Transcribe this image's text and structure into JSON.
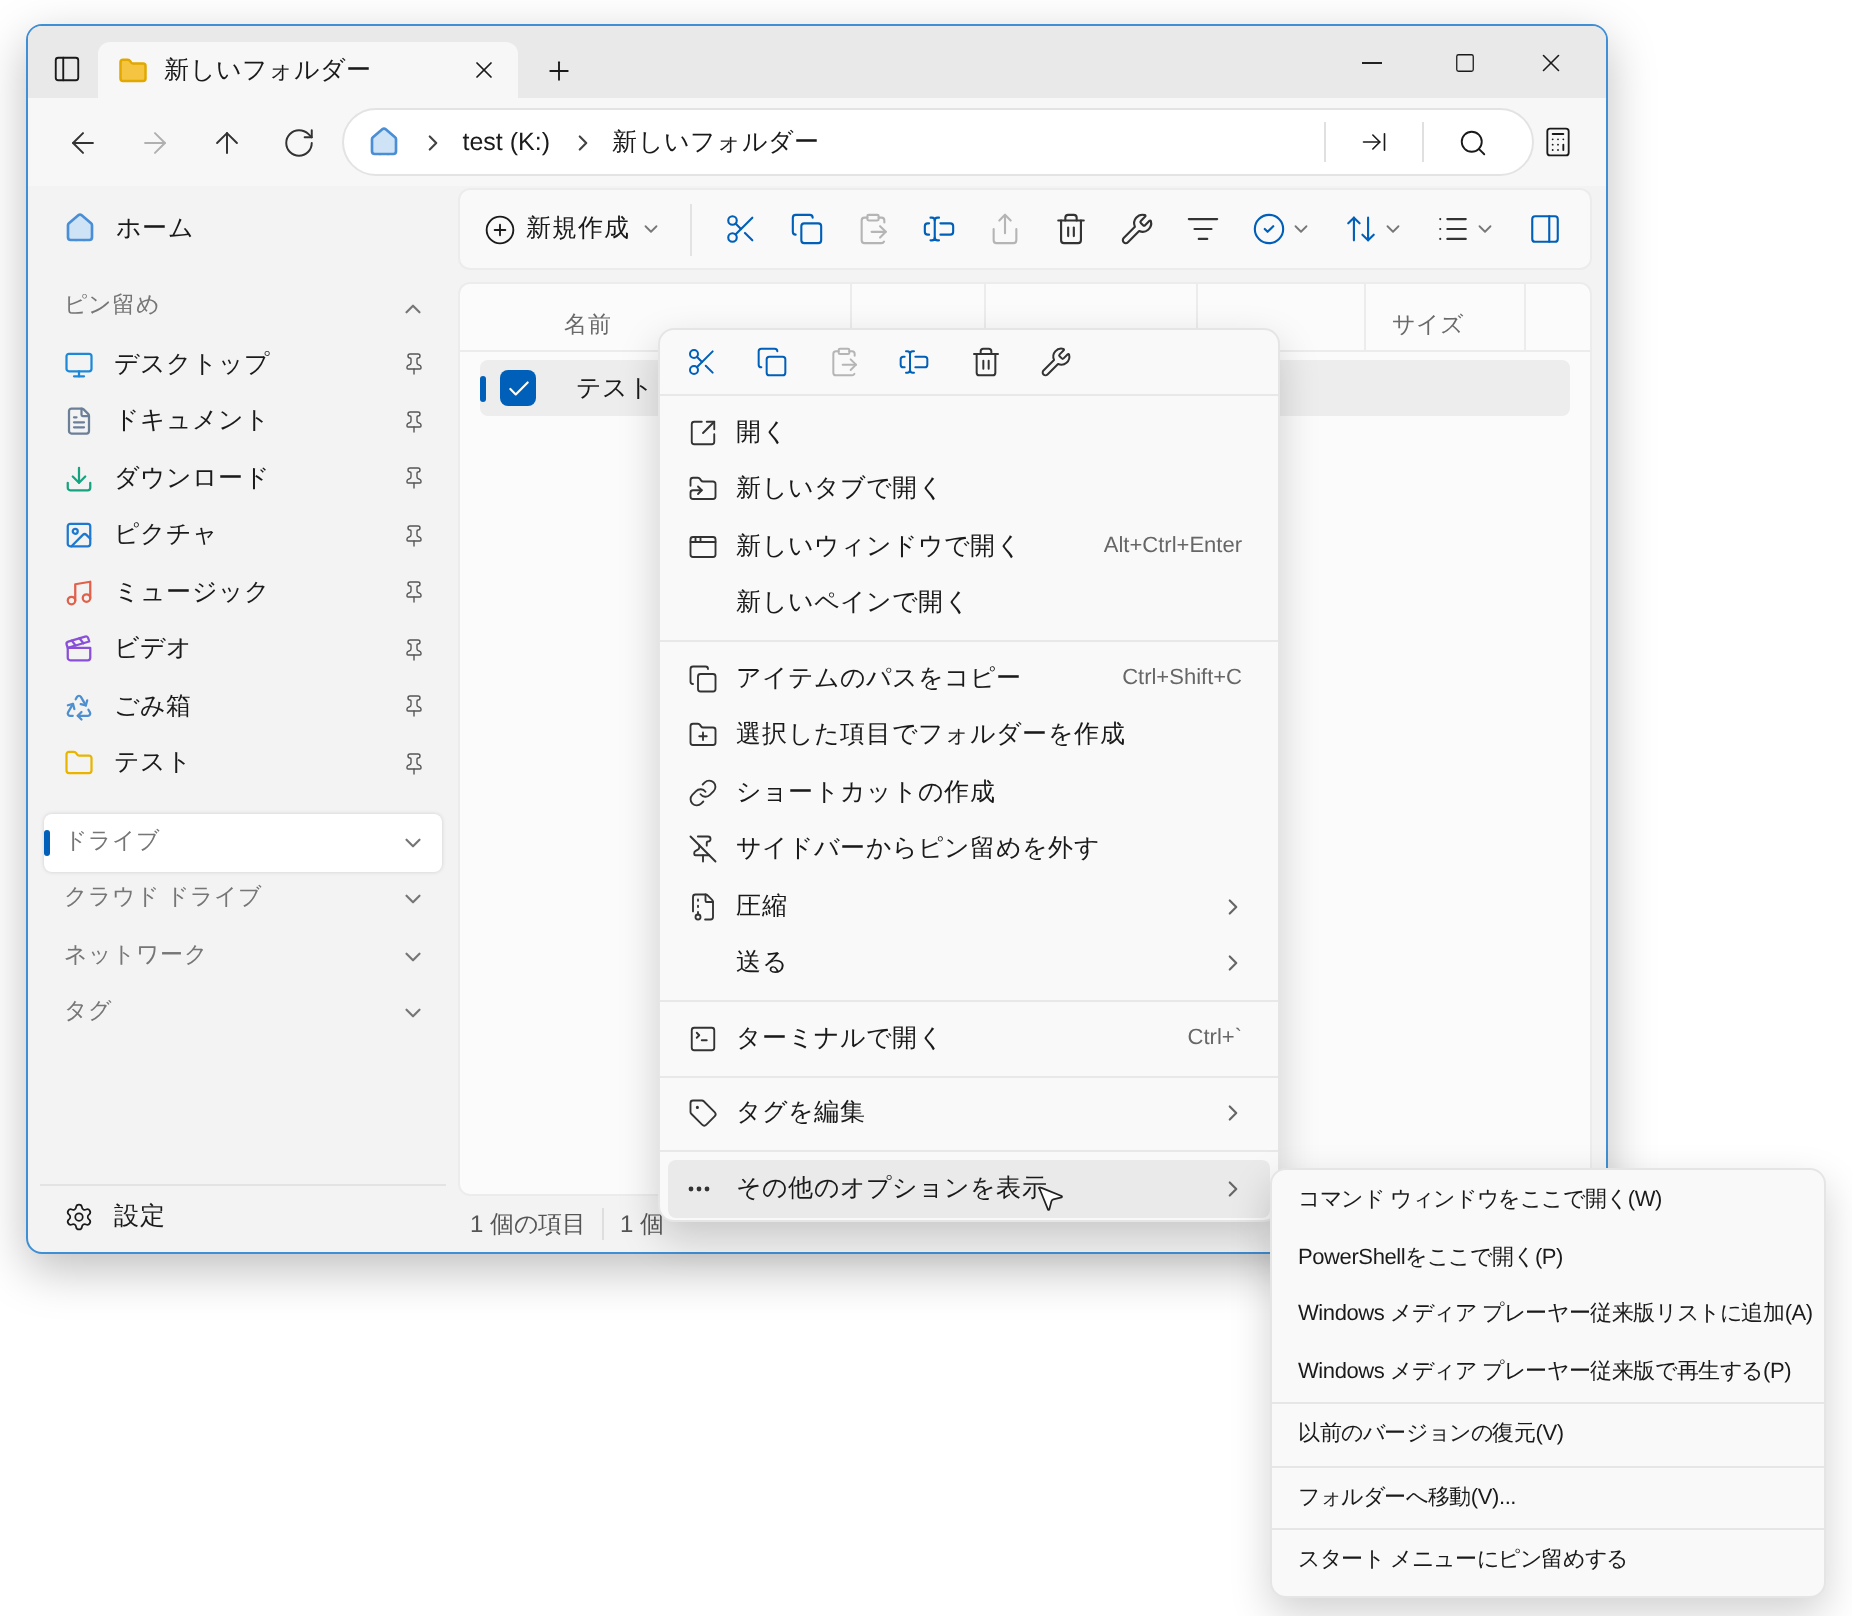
{
  "window": {
    "tab": {
      "title": "新しいフォルダー",
      "selected": true
    }
  },
  "nav": [
    {
      "kind": "back",
      "disabled": false
    },
    {
      "kind": "forward",
      "disabled": true
    },
    {
      "kind": "up",
      "disabled": false
    },
    {
      "kind": "refresh",
      "disabled": false
    }
  ],
  "address": {
    "crumbs": [
      "test (K:)",
      "新しいフォルダー"
    ]
  },
  "toolbar": {
    "new_button": "新規作成",
    "buttons": [
      {
        "kind": "cut",
        "disabled": false
      },
      {
        "kind": "copy",
        "disabled": false
      },
      {
        "kind": "paste",
        "disabled": true
      },
      {
        "kind": "rename",
        "disabled": false
      },
      {
        "kind": "share",
        "disabled": true
      },
      {
        "kind": "delete",
        "disabled": false
      },
      {
        "kind": "properties",
        "disabled": false
      }
    ],
    "view_buttons": [
      {
        "kind": "filter",
        "dropdown": false
      },
      {
        "kind": "select",
        "dropdown": true
      },
      {
        "kind": "sort",
        "dropdown": true
      },
      {
        "kind": "layout",
        "dropdown": true
      },
      {
        "kind": "pane",
        "dropdown": false
      }
    ]
  },
  "sidebar": {
    "home": "ホーム",
    "pinned_header": {
      "label": "ピン留め",
      "expanded": true
    },
    "pinned": [
      {
        "label": "デスクトップ",
        "kind": "desktop"
      },
      {
        "label": "ドキュメント",
        "kind": "documents"
      },
      {
        "label": "ダウンロード",
        "kind": "downloads"
      },
      {
        "label": "ピクチャ",
        "kind": "pictures"
      },
      {
        "label": "ミュージック",
        "kind": "music"
      },
      {
        "label": "ビデオ",
        "kind": "videos"
      },
      {
        "label": "ごみ箱",
        "kind": "recycle"
      },
      {
        "label": "テスト",
        "kind": "folder"
      }
    ],
    "sections": [
      {
        "label": "ドライブ",
        "selected": true,
        "expanded": false
      },
      {
        "label": "クラウド ドライブ",
        "selected": false,
        "expanded": false
      },
      {
        "label": "ネットワーク",
        "selected": false,
        "expanded": false
      },
      {
        "label": "タグ",
        "selected": false,
        "expanded": false
      }
    ],
    "settings": "設定"
  },
  "table": {
    "columns": [
      "名前",
      "サイズ"
    ],
    "rows": [
      {
        "name": "テスト",
        "checked": true,
        "selected": true
      }
    ]
  },
  "status_bar": [
    "1 個の項目",
    "1 個"
  ],
  "context_menu": {
    "actions": [
      {
        "kind": "cut",
        "disabled": false
      },
      {
        "kind": "copy",
        "disabled": false
      },
      {
        "kind": "paste",
        "disabled": true
      },
      {
        "kind": "rename",
        "disabled": false
      },
      {
        "kind": "delete",
        "disabled": false
      },
      {
        "kind": "properties",
        "disabled": false
      }
    ],
    "groups": [
      [
        {
          "label": "開く",
          "kind": "open",
          "selected": false,
          "submenu": false
        },
        {
          "label": "新しいタブで開く",
          "kind": "new-tab",
          "selected": false,
          "submenu": false
        },
        {
          "label": "新しいウィンドウで開く",
          "kind": "new-window",
          "shortcut": "Alt+Ctrl+Enter",
          "selected": false,
          "submenu": false
        },
        {
          "label": "新しいペインで開く",
          "kind": "plain",
          "selected": false,
          "submenu": false
        }
      ],
      [
        {
          "label": "アイテムのパスをコピー",
          "kind": "copy-path",
          "shortcut": "Ctrl+Shift+C",
          "selected": false,
          "submenu": false
        },
        {
          "label": "選択した項目でフォルダーを作成",
          "kind": "new-folder",
          "selected": false,
          "submenu": false
        },
        {
          "label": "ショートカットの作成",
          "kind": "link",
          "selected": false,
          "submenu": false
        },
        {
          "label": "サイドバーからピン留めを外す",
          "kind": "unpin",
          "selected": false,
          "submenu": false
        },
        {
          "label": "圧縮",
          "kind": "archive",
          "selected": false,
          "submenu": true
        },
        {
          "label": "送る",
          "kind": "plain",
          "selected": false,
          "submenu": true
        }
      ],
      [
        {
          "label": "ターミナルで開く",
          "kind": "terminal",
          "shortcut": "Ctrl+`",
          "selected": false,
          "submenu": false
        }
      ],
      [
        {
          "label": "タグを編集",
          "kind": "tag",
          "selected": false,
          "submenu": true
        }
      ],
      [
        {
          "label": "その他のオプションを表示",
          "kind": "more",
          "selected": true,
          "submenu": true
        }
      ]
    ]
  },
  "submenu": {
    "groups": [
      [
        "コマンド ウィンドウをここで開く(W)",
        "PowerShellをここで開く(P)",
        "Windows メディア プレーヤー従来版リストに追加(A)",
        "Windows メディア プレーヤー従来版で再生する(P)"
      ],
      [
        "以前のバージョンの復元(V)"
      ],
      [
        "フォルダーへ移動(V)..."
      ],
      [
        "スタート メニューにピン留めする"
      ]
    ]
  }
}
